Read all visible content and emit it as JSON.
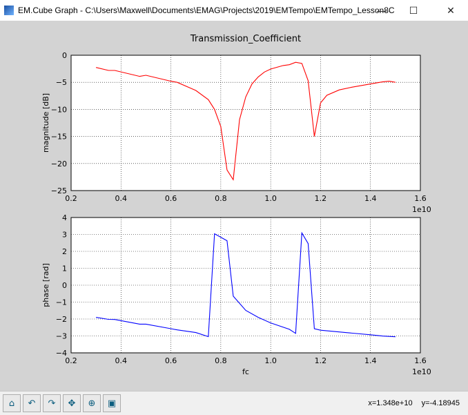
{
  "window": {
    "title": "EM.Cube Graph - C:\\Users\\Maxwell\\Documents\\EMAG\\Projects\\2019\\EMTempo\\EMTempo_Lesson8C",
    "minimize": "—",
    "maximize": "☐",
    "close": "✕"
  },
  "toolbar": {
    "buttons": [
      {
        "name": "home",
        "glyph": "⌂"
      },
      {
        "name": "back",
        "glyph": "↶"
      },
      {
        "name": "forward",
        "glyph": "↷"
      },
      {
        "name": "pan",
        "glyph": "✥"
      },
      {
        "name": "zoom",
        "glyph": "⊕"
      },
      {
        "name": "save",
        "glyph": "▣"
      }
    ],
    "x_readout": "x=1.348e+10",
    "y_readout": "y=-4.18945"
  },
  "chart_data": [
    {
      "type": "line",
      "title": "Transmission_Coefficient",
      "xlabel": "",
      "ylabel": "magnitude [dB]",
      "xlim": [
        0.2,
        1.6
      ],
      "ylim": [
        -25,
        0
      ],
      "x_offset_label": "1e10",
      "xticks": [
        "0.2",
        "0.4",
        "0.6",
        "0.8",
        "1.0",
        "1.2",
        "1.4",
        "1.6"
      ],
      "yticks": [
        "0",
        "−5",
        "−10",
        "−15",
        "−20",
        "−25"
      ],
      "ytick_values": [
        0,
        -5,
        -10,
        -15,
        -20,
        -25
      ],
      "grid": true,
      "color": "#ff0000",
      "x": [
        0.3,
        0.35,
        0.375,
        0.475,
        0.5,
        0.6,
        0.625,
        0.7,
        0.75,
        0.775,
        0.8,
        0.825,
        0.85,
        0.875,
        0.9,
        0.925,
        0.95,
        0.975,
        1.0,
        1.05,
        1.075,
        1.1,
        1.125,
        1.15,
        1.175,
        1.2,
        1.225,
        1.275,
        1.325,
        1.4,
        1.45,
        1.475,
        1.5
      ],
      "y": [
        -2.26,
        -2.8,
        -2.8,
        -3.9,
        -3.7,
        -4.8,
        -5.0,
        -6.5,
        -8.2,
        -10.0,
        -13.2,
        -21.2,
        -23.0,
        -11.9,
        -7.7,
        -5.3,
        -4.0,
        -3.1,
        -2.55,
        -1.9,
        -1.75,
        -1.3,
        -1.5,
        -4.7,
        -15.0,
        -8.8,
        -7.4,
        -6.4,
        -5.9,
        -5.3,
        -4.9,
        -4.8,
        -5.0
      ]
    },
    {
      "type": "line",
      "title": "",
      "xlabel": "fc",
      "ylabel": "phase [rad]",
      "xlim": [
        0.2,
        1.6
      ],
      "ylim": [
        -4,
        4
      ],
      "x_offset_label": "1e10",
      "xticks": [
        "0.2",
        "0.4",
        "0.6",
        "0.8",
        "1.0",
        "1.2",
        "1.4",
        "1.6"
      ],
      "yticks": [
        "4",
        "3",
        "2",
        "1",
        "0",
        "−1",
        "−2",
        "−3",
        "−4"
      ],
      "ytick_values": [
        4,
        3,
        2,
        1,
        0,
        -1,
        -2,
        -3,
        -4
      ],
      "grid": true,
      "color": "#0000ff",
      "x": [
        0.3,
        0.35,
        0.375,
        0.475,
        0.5,
        0.6,
        0.625,
        0.7,
        0.75,
        0.775,
        0.825,
        0.85,
        0.9,
        0.95,
        1.0,
        1.075,
        1.1,
        1.125,
        1.15,
        1.175,
        1.2,
        1.3,
        1.4,
        1.45,
        1.5
      ],
      "y": [
        -1.9,
        -2.02,
        -2.03,
        -2.3,
        -2.3,
        -2.57,
        -2.64,
        -2.8,
        -3.04,
        3.04,
        2.63,
        -0.65,
        -1.49,
        -1.9,
        -2.23,
        -2.61,
        -2.85,
        3.09,
        2.46,
        -2.57,
        -2.66,
        -2.8,
        -2.93,
        -3.01,
        -3.05
      ]
    }
  ]
}
